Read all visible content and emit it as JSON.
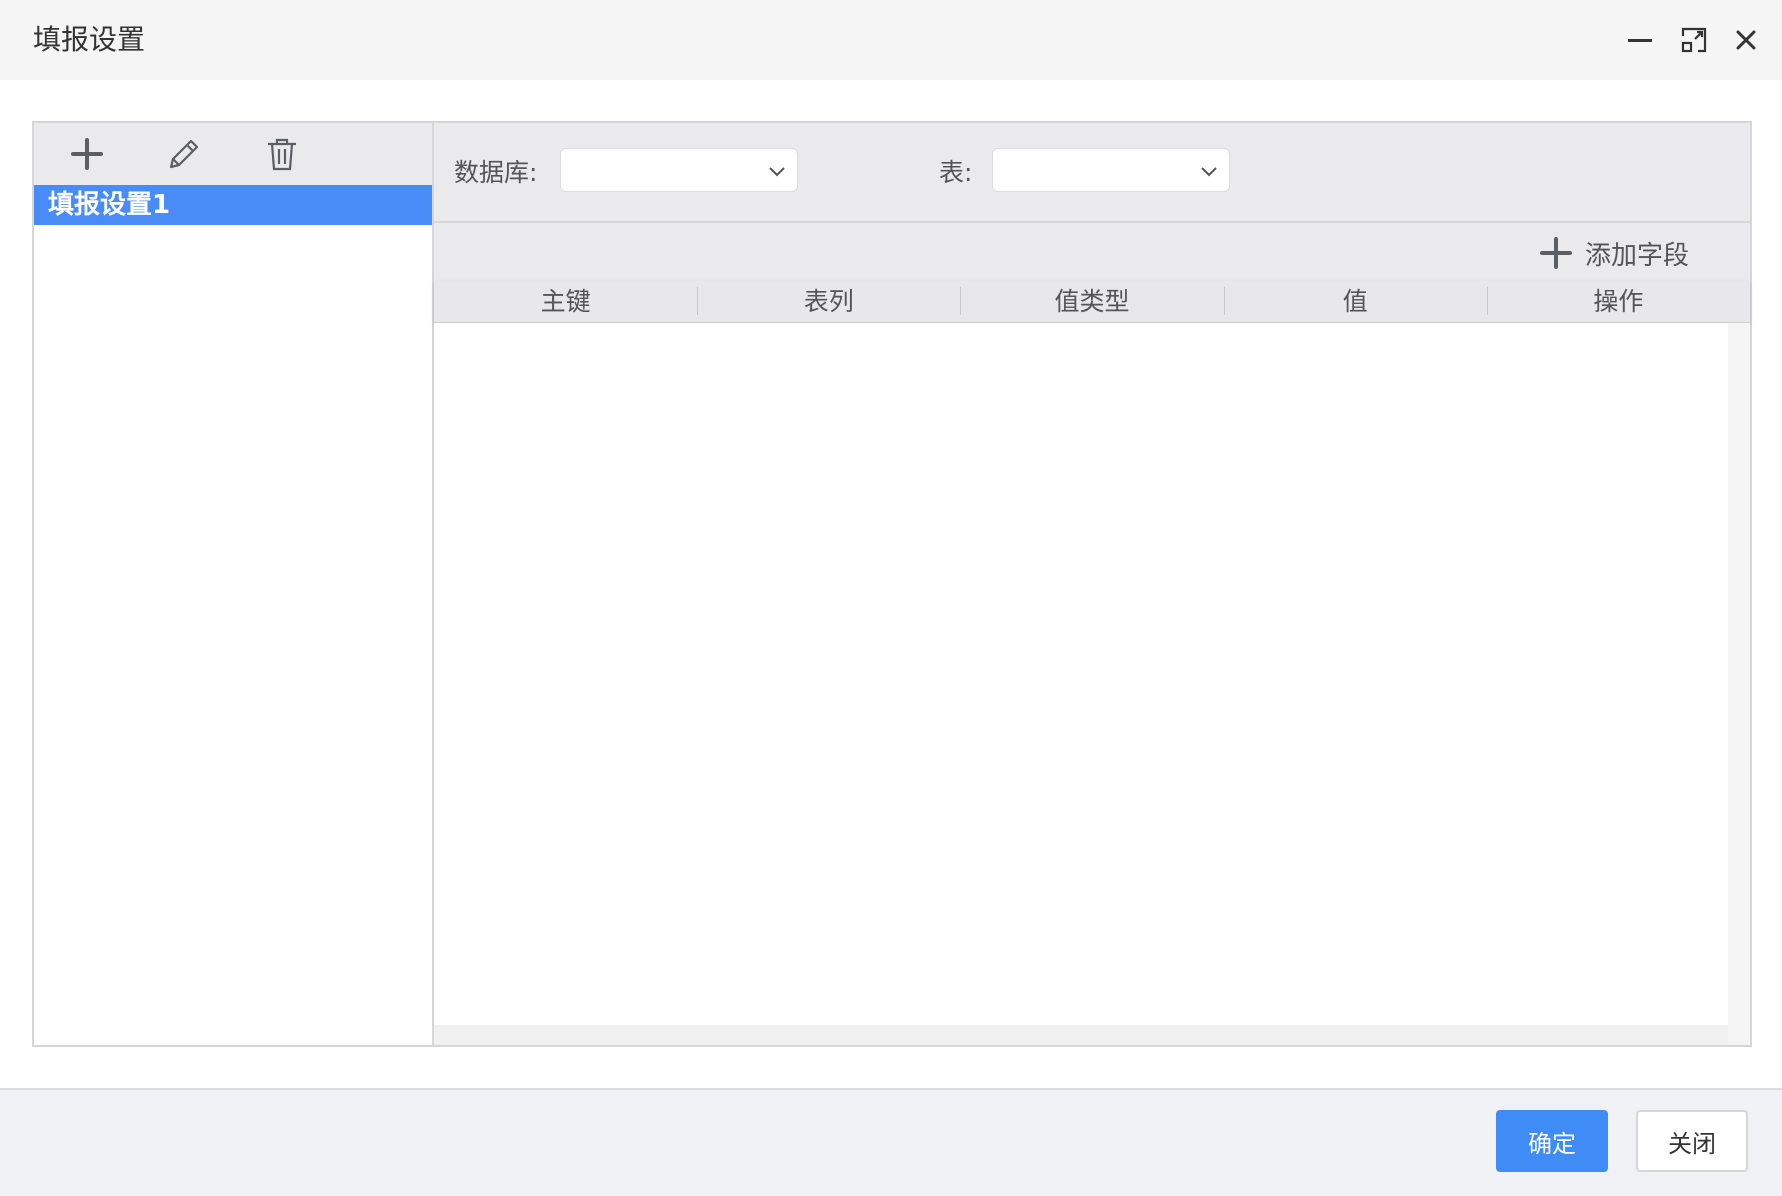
{
  "window": {
    "title": "填报设置",
    "controls": [
      "minimize-icon",
      "maximize-icon",
      "close-icon"
    ]
  },
  "left_panel": {
    "toolbar_icons": [
      "plus-icon",
      "pencil-icon",
      "trash-icon"
    ],
    "items": [
      {
        "label": "填报设置1",
        "selected": true
      }
    ]
  },
  "right_panel": {
    "database_label": "数据库:",
    "database_value": "",
    "table_label": "表:",
    "table_value": "",
    "add_field_label": "添加字段",
    "columns": [
      "主键",
      "表列",
      "值类型",
      "值",
      "操作"
    ],
    "rows": []
  },
  "footer": {
    "confirm_label": "确定",
    "close_label": "关闭"
  },
  "colors": {
    "accent": "#3f8cf7",
    "selected_item": "#4a8cf7",
    "toolbar_bg": "#eaeaec"
  }
}
